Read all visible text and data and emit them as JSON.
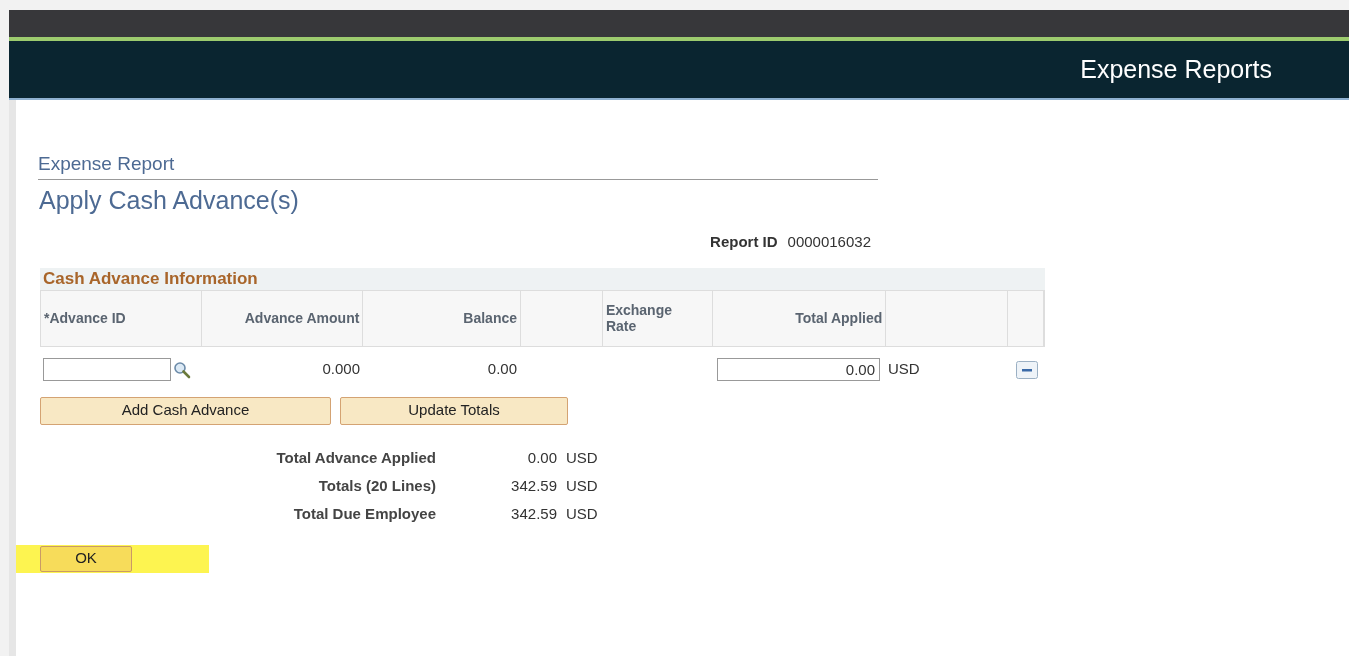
{
  "header": {
    "title": "Expense Reports"
  },
  "page": {
    "breadcrumb": "Expense Report",
    "title": "Apply Cash Advance(s)"
  },
  "report_id": {
    "label": "Report ID",
    "value": "0000016032"
  },
  "grid": {
    "title": "Cash Advance Information",
    "columns": [
      "*Advance ID",
      "Advance Amount",
      "Balance",
      "Exchange Rate",
      "Total Applied"
    ],
    "rows": [
      {
        "advance_amount": "0.000",
        "balance": "0.00",
        "total_applied": "0.00",
        "currency": "USD"
      }
    ]
  },
  "buttons": [
    {
      "label": "Add Cash Advance"
    },
    {
      "label": "Update Totals"
    }
  ],
  "totals": [
    {
      "label": "Total Advance Applied",
      "value": "0.00",
      "currency": "USD"
    },
    {
      "label": "Totals (20 Lines)",
      "value": "342.59",
      "currency": "USD"
    },
    {
      "label": "Total Due Employee",
      "value": "342.59",
      "currency": "USD"
    }
  ],
  "ok_button": {
    "label": "OK",
    "highlighted": true
  }
}
